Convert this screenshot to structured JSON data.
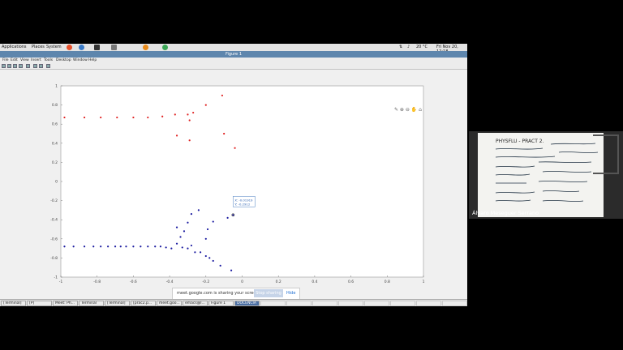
{
  "top_panel": {
    "menus": [
      "Applications",
      "Places",
      "System"
    ],
    "weather": "20 °C",
    "datetime": "Fri Nov 20, 12:18"
  },
  "window": {
    "title": "Figure 1",
    "menu": [
      "File",
      "Edit",
      "View",
      "Insert",
      "Tools",
      "Desktop",
      "Window",
      "Help"
    ]
  },
  "chart_data": {
    "type": "scatter",
    "title": "",
    "xlabel": "",
    "ylabel": "",
    "xlim": [
      -1,
      1
    ],
    "ylim": [
      -1,
      1
    ],
    "xticks": [
      "-1",
      "-0.8",
      "-0.6",
      "-0.4",
      "-0.2",
      "0",
      "0.2",
      "0.4",
      "0.6",
      "0.8",
      "1"
    ],
    "yticks": [
      "1",
      "0.8",
      "0.6",
      "0.4",
      "0.2",
      "0",
      "-0.2",
      "-0.4",
      "-0.6",
      "-0.8",
      "-1"
    ],
    "series": [
      {
        "color": "#e02020",
        "points": [
          [
            -0.98,
            0.67
          ],
          [
            -0.87,
            0.67
          ],
          [
            -0.78,
            0.67
          ],
          [
            -0.69,
            0.67
          ],
          [
            -0.6,
            0.67
          ],
          [
            -0.52,
            0.67
          ],
          [
            -0.44,
            0.68
          ],
          [
            -0.37,
            0.7
          ],
          [
            -0.3,
            0.7
          ],
          [
            -0.27,
            0.72
          ],
          [
            -0.29,
            0.64
          ],
          [
            -0.2,
            0.8
          ],
          [
            -0.11,
            0.9
          ],
          [
            -0.36,
            0.48
          ],
          [
            -0.29,
            0.43
          ],
          [
            -0.1,
            0.5
          ],
          [
            -0.04,
            0.35
          ]
        ]
      },
      {
        "color": "#1a1aa0",
        "points": [
          [
            -0.98,
            -0.68
          ],
          [
            -0.93,
            -0.68
          ],
          [
            -0.87,
            -0.68
          ],
          [
            -0.82,
            -0.68
          ],
          [
            -0.78,
            -0.68
          ],
          [
            -0.74,
            -0.68
          ],
          [
            -0.7,
            -0.68
          ],
          [
            -0.67,
            -0.68
          ],
          [
            -0.64,
            -0.68
          ],
          [
            -0.6,
            -0.68
          ],
          [
            -0.56,
            -0.68
          ],
          [
            -0.52,
            -0.68
          ],
          [
            -0.48,
            -0.68
          ],
          [
            -0.45,
            -0.68
          ],
          [
            -0.42,
            -0.69
          ],
          [
            -0.39,
            -0.7
          ],
          [
            -0.36,
            -0.48
          ],
          [
            -0.34,
            -0.58
          ],
          [
            -0.32,
            -0.52
          ],
          [
            -0.3,
            -0.43
          ],
          [
            -0.28,
            -0.34
          ],
          [
            -0.24,
            -0.3
          ],
          [
            -0.19,
            -0.5
          ],
          [
            -0.16,
            -0.42
          ],
          [
            -0.08,
            -0.38
          ],
          [
            -0.05,
            -0.35
          ],
          [
            -0.36,
            -0.65
          ],
          [
            -0.33,
            -0.69
          ],
          [
            -0.3,
            -0.7
          ],
          [
            -0.28,
            -0.67
          ],
          [
            -0.26,
            -0.74
          ],
          [
            -0.23,
            -0.74
          ],
          [
            -0.2,
            -0.78
          ],
          [
            -0.18,
            -0.8
          ],
          [
            -0.16,
            -0.83
          ],
          [
            -0.12,
            -0.88
          ],
          [
            -0.06,
            -0.93
          ],
          [
            -0.2,
            -0.6
          ]
        ]
      }
    ],
    "datatip": {
      "point": [
        -0.05,
        -0.35
      ],
      "lines": [
        "X: -0.01919",
        "Y: -0.2912"
      ]
    }
  },
  "share_bar": {
    "message": "meet.google.com is sharing your screen.",
    "stop_label": "Stop sharing",
    "hide_label": "Hide"
  },
  "taskbar": [
    {
      "label": "[Terminal]",
      "state": "normal"
    },
    {
      "label": "[P]",
      "state": "normal"
    },
    {
      "label": "Meet: Ph...",
      "state": "normal"
    },
    {
      "label": "Terminal",
      "state": "normal"
    },
    {
      "label": "[Terminal]",
      "state": "normal"
    },
    {
      "label": "[prac2.p...",
      "state": "normal"
    },
    {
      "label": "meet.goo...",
      "state": "normal"
    },
    {
      "label": "emacs@l...",
      "state": "normal"
    },
    {
      "label": "Figure 1",
      "state": "normal"
    },
    {
      "label": "DOCENCIA",
      "state": "active"
    },
    {
      "label": "",
      "state": "faded"
    },
    {
      "label": "",
      "state": "faded"
    },
    {
      "label": "",
      "state": "faded"
    },
    {
      "label": "",
      "state": "faded"
    },
    {
      "label": "",
      "state": "faded"
    },
    {
      "label": "",
      "state": "faded"
    },
    {
      "label": "",
      "state": "faded"
    },
    {
      "label": "",
      "state": "faded"
    }
  ],
  "webcam": {
    "name": "Álvaro Meseguer Serrano",
    "board_title": "PHYSFLU - PRACT 2."
  }
}
